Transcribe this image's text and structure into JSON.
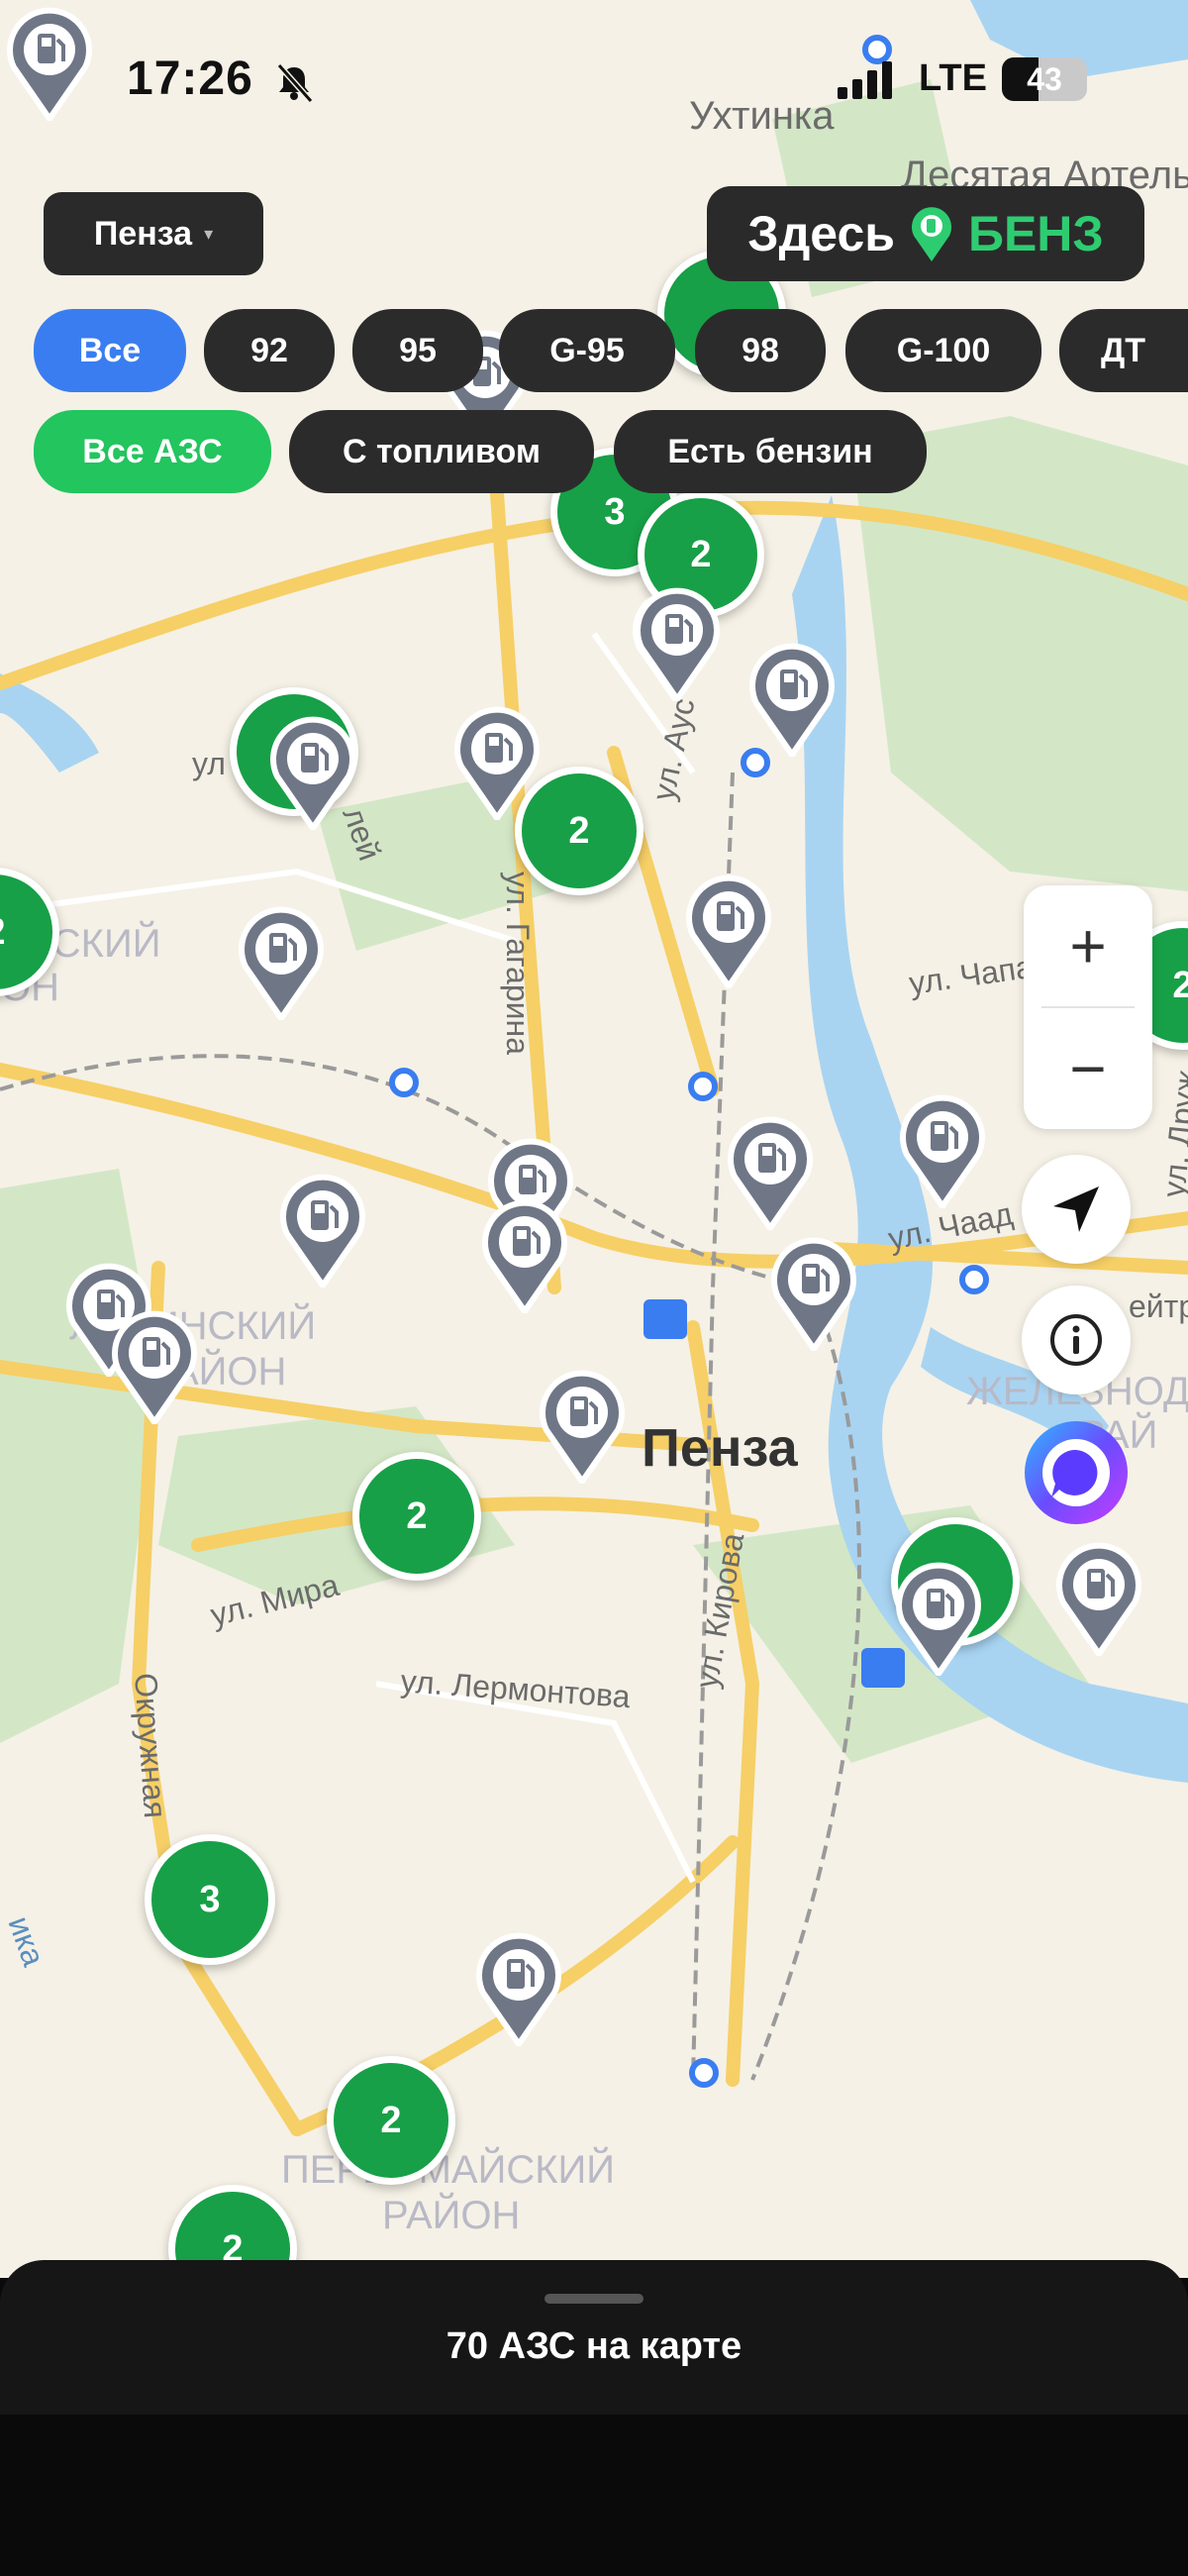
{
  "status_bar": {
    "time": "17:26",
    "network": "LTE",
    "battery": "43"
  },
  "city_selector": {
    "label": "Пенза",
    "caret": "▾"
  },
  "brand": {
    "word1": "Здесь",
    "word2": "БЕНЗ"
  },
  "fuel_filters": [
    "Все",
    "92",
    "95",
    "G-95",
    "98",
    "G-100",
    "ДТ"
  ],
  "station_filters": [
    "Все АЗС",
    "С топливом",
    "Есть бензин"
  ],
  "map": {
    "labels": {
      "north_village": "Ухтинка",
      "north_district": "Десятая Артель",
      "city": "Пенза",
      "district_left": "ЙСКИЙ",
      "district_left2": "ОН",
      "district_west": "ЛЕНИНСКИЙ",
      "district_west2": "РАЙОН",
      "district_east": "ЖЕЛЕЗНОД",
      "district_east2": "РАЙ",
      "district_south": "ПЕРВОМАЙСКИЙ",
      "district_south2": "РАЙОН",
      "street_gagarina": "ул. Гагарина",
      "street_mira": "ул. Мира",
      "street_lermontova": "ул. Лермонтова",
      "street_kirova": "ул. Кирова",
      "street_okruzhnaya": "Окружная",
      "street_chapaeva": "ул. Чапа",
      "street_chaadaeva": "ул. Чаад",
      "street_aus": "ул. Аус",
      "street_ul": "ул",
      "street_lei": "лей",
      "street_druzh": "ул. Друж",
      "street_eitr": "ейтр",
      "river": "ика"
    },
    "clusters": [
      "3",
      "2",
      "2",
      "2",
      "2",
      "3",
      "2",
      "2",
      "2"
    ]
  },
  "controls": {
    "zoom_in": "+",
    "zoom_out": "−",
    "info": "i"
  },
  "summary": {
    "text": "70 АЗС на карте"
  },
  "colors": {
    "accent_green": "#17a047",
    "accent_blue": "#3a7df0",
    "brand_green": "#2ecc71",
    "dark_pill": "#2b2b2b"
  }
}
